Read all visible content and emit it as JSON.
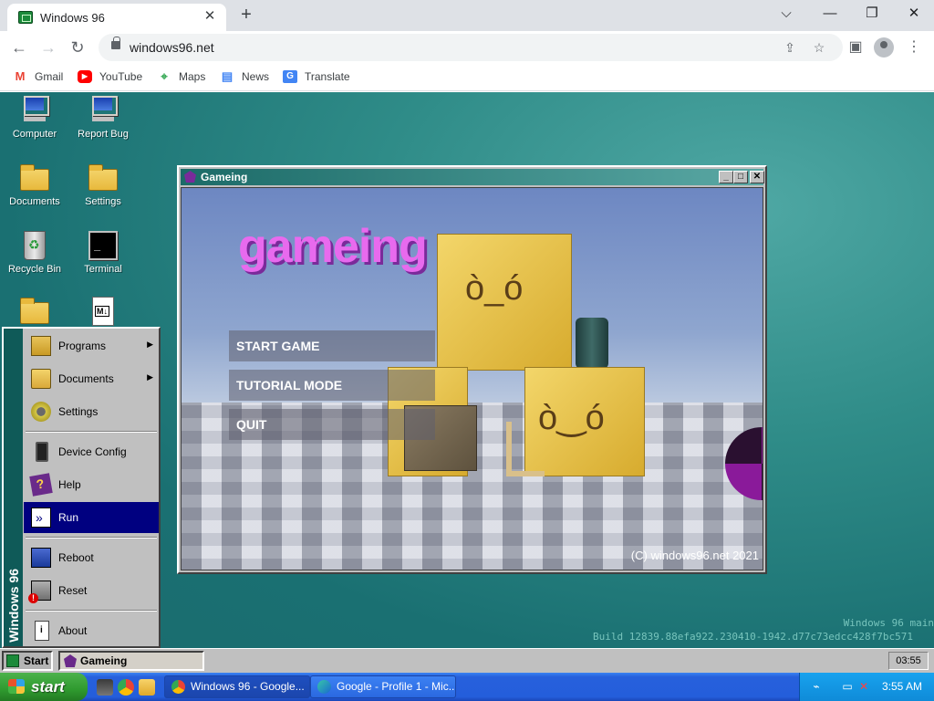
{
  "browser": {
    "tab_title": "Windows 96",
    "new_tab": "+",
    "controls": {
      "minimize": "⌵",
      "restore": "—",
      "maximize": "❐",
      "close": "✕"
    },
    "url": "windows96.net",
    "bookmarks": [
      {
        "label": "Gmail",
        "icon": "gmail-icon",
        "color": "#ea4335"
      },
      {
        "label": "YouTube",
        "icon": "youtube-icon",
        "color": "#ff0000"
      },
      {
        "label": "Maps",
        "icon": "maps-icon",
        "color": "#34a853"
      },
      {
        "label": "News",
        "icon": "news-icon",
        "color": "#4285f4"
      },
      {
        "label": "Translate",
        "icon": "translate-icon",
        "color": "#4285f4"
      }
    ]
  },
  "desktop": {
    "icons": [
      {
        "label": "Computer",
        "icon": "computer-icon"
      },
      {
        "label": "Report Bug",
        "icon": "report-bug-icon"
      },
      {
        "label": "Documents",
        "icon": "documents-folder-icon"
      },
      {
        "label": "Settings",
        "icon": "settings-folder-icon"
      },
      {
        "label": "Recycle Bin",
        "icon": "recycle-bin-icon"
      },
      {
        "label": "Terminal",
        "icon": "terminal-icon"
      },
      {
        "label": "",
        "icon": "folder-icon"
      },
      {
        "label": "",
        "icon": "markdown-file-icon"
      }
    ],
    "build_line1": "Windows 96 main",
    "build_line2": "Build 12839.88efa922.230410-1942.d77c73edcc428f7bc571"
  },
  "game_window": {
    "title": "Gameing",
    "buttons": {
      "minimize": "_",
      "maximize": "□",
      "close": "✕"
    },
    "logo_text": "gameing",
    "menu": [
      "START GAME",
      "TUTORIAL MODE",
      "QUIT"
    ],
    "copyright": "(C) windows96.net 2021"
  },
  "start_menu": {
    "banner": "Windows 96",
    "items": [
      {
        "label": "Programs",
        "icon": "programs-icon",
        "submenu": true
      },
      {
        "label": "Documents",
        "icon": "documents-icon",
        "submenu": true
      },
      {
        "label": "Settings",
        "icon": "settings-icon",
        "submenu": false
      },
      {
        "label": "Device Config",
        "icon": "device-config-icon",
        "submenu": false
      },
      {
        "label": "Help",
        "icon": "help-icon",
        "submenu": false
      },
      {
        "label": "Run",
        "icon": "run-icon",
        "submenu": false,
        "highlighted": true
      },
      {
        "label": "Reboot",
        "icon": "reboot-icon",
        "submenu": false
      },
      {
        "label": "Reset",
        "icon": "reset-icon",
        "submenu": false
      },
      {
        "label": "About",
        "icon": "about-icon",
        "submenu": false
      }
    ],
    "submenu_arrow": "▶"
  },
  "w96_taskbar": {
    "start_label": "Start",
    "task_label": "Gameing",
    "clock": "03:55"
  },
  "xp_taskbar": {
    "start_label": "start",
    "tasks": [
      {
        "label": "Windows 96 - Google...",
        "icon": "chrome-icon",
        "active": true
      },
      {
        "label": "Google - Profile 1 - Mic...",
        "icon": "edge-icon",
        "active": false
      }
    ],
    "time": "3:55 AM"
  }
}
